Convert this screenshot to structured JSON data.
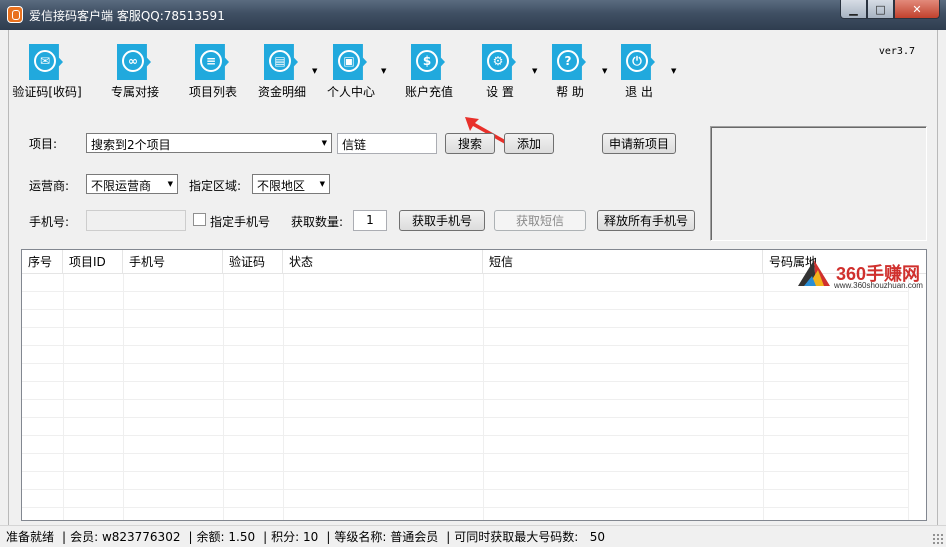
{
  "window": {
    "title": "爱信接码客户端   客服QQ:78513591",
    "controls": {
      "minimize": "▁",
      "maximize": "□",
      "close": "✕"
    }
  },
  "toolbar": {
    "version": "ver3.7",
    "items": [
      {
        "label": "验证码[收码]",
        "icon": "email-icon",
        "glyph": "✉",
        "has_dropdown": false
      },
      {
        "label": "专属对接",
        "icon": "link-icon",
        "glyph": "∞",
        "has_dropdown": false
      },
      {
        "label": "项目列表",
        "icon": "list-icon",
        "glyph": "≡",
        "has_dropdown": false
      },
      {
        "label": "资金明细",
        "icon": "document-icon",
        "glyph": "▤",
        "has_dropdown": true
      },
      {
        "label": "个人中心",
        "icon": "id-card-icon",
        "glyph": "▣",
        "has_dropdown": true
      },
      {
        "label": "账户充值",
        "icon": "money-bag-icon",
        "glyph": "$",
        "has_dropdown": false
      },
      {
        "label": "设  置",
        "icon": "gear-icon",
        "glyph": "⚙",
        "has_dropdown": true
      },
      {
        "label": "帮  助",
        "icon": "help-icon",
        "glyph": "?",
        "has_dropdown": true
      },
      {
        "label": "退  出",
        "icon": "power-icon",
        "glyph": "⏻",
        "has_dropdown": true
      }
    ]
  },
  "form": {
    "project_label": "项目:",
    "project_selected": "搜索到2个项目",
    "search_value": "信链",
    "search_button": "搜索",
    "add_button": "添加",
    "apply_button": "申请新项目",
    "carrier_label": "运营商:",
    "carrier_selected": "不限运营商",
    "region_label": "指定区域:",
    "region_selected": "不限地区",
    "phone_label": "手机号:",
    "phone_value": "",
    "specify_phone_label": "指定手机号",
    "quantity_label": "获取数量:",
    "quantity_value": "1",
    "get_phone_button": "获取手机号",
    "get_sms_button": "获取短信",
    "release_all_button": "释放所有手机号"
  },
  "table": {
    "columns": [
      "序号",
      "项目ID",
      "手机号",
      "验证码",
      "状态",
      "短信",
      "号码属地"
    ],
    "rows": []
  },
  "watermark": {
    "text": "360手赚网",
    "sub": "www.360shouzhuan.com"
  },
  "statusbar": {
    "ready": "准备就绪",
    "member_label": "会员:",
    "member_value": "w823776302",
    "balance_label": "余额:",
    "balance_value": "1.50",
    "points_label": "积分:",
    "points_value": "10",
    "level_label": "等级名称:",
    "level_value": "普通会员",
    "max_label": "可同时获取最大号码数:",
    "max_value": "50"
  },
  "colors": {
    "icon_blue": "#21a9dd",
    "annotation_red": "#e8302a"
  }
}
